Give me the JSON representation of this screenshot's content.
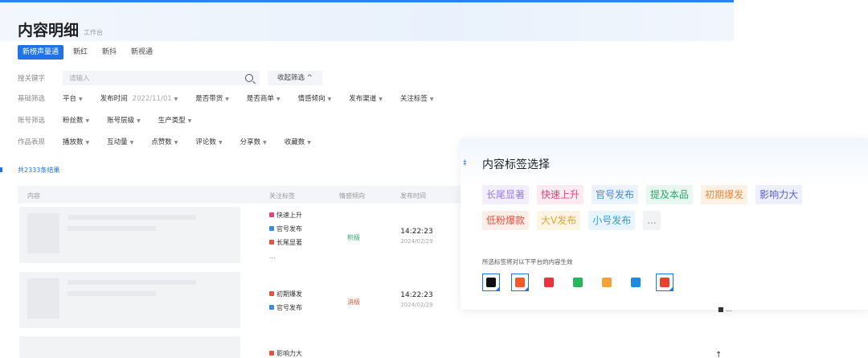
{
  "header": {
    "title": "内容明细",
    "subtitle": "工作台"
  },
  "tabs": [
    {
      "label": "新榜声量通",
      "active": true
    },
    {
      "label": "新红",
      "active": false
    },
    {
      "label": "新抖",
      "active": false
    },
    {
      "label": "新视通",
      "active": false
    }
  ],
  "search": {
    "label": "搜关键字",
    "placeholder": "请输入",
    "collapse_label": "收起筛选 ^"
  },
  "filters": {
    "basic": {
      "label": "基础筛选",
      "items": [
        "平台",
        "发布时间",
        "是否带货",
        "是否商单",
        "情感倾向",
        "发布渠道",
        "关注标签"
      ],
      "date_value": "2022/11/01"
    },
    "account": {
      "label": "账号筛选",
      "items": [
        "粉丝数",
        "账号层级",
        "生产类型"
      ]
    },
    "works": {
      "label": "作品表现",
      "items": [
        "播放数",
        "互动量",
        "点赞数",
        "评论数",
        "分享数",
        "收藏数"
      ]
    }
  },
  "result_count": "共2333条结果",
  "table": {
    "headers": {
      "content": "内容",
      "tags": "关注标签",
      "emotion": "情感倾向",
      "time": "发布时间"
    },
    "rows": [
      {
        "tags": [
          "快速上升",
          "官号发布",
          "长尾显著",
          "..."
        ],
        "emotion": "积极",
        "time": "14:22:23",
        "date": "2024/02/29"
      },
      {
        "tags": [
          "初期爆发",
          "官号发布"
        ],
        "emotion": "消极",
        "time": "14:22:23",
        "date": "2024/02/29"
      },
      {
        "tags": [
          "影响力大"
        ],
        "emotion": "",
        "time": "",
        "date": ""
      }
    ]
  },
  "panel": {
    "title": "内容标签选择",
    "chips": [
      {
        "label": "长尾显著",
        "color": "#9a7fd8",
        "bg": "#f2eefc"
      },
      {
        "label": "快速上升",
        "color": "#e0457b",
        "bg": "#fdebf1"
      },
      {
        "label": "官号发布",
        "color": "#3b8be8",
        "bg": "#ebf3fd"
      },
      {
        "label": "提及本品",
        "color": "#2fa86a",
        "bg": "#e8f7ef"
      },
      {
        "label": "初期爆发",
        "color": "#f08a3c",
        "bg": "#fdf1e6"
      },
      {
        "label": "影响力大",
        "color": "#5b5fc7",
        "bg": "#eeeffc"
      },
      {
        "label": "低粉爆款",
        "color": "#e5553e",
        "bg": "#fdeeea"
      },
      {
        "label": "大V发布",
        "color": "#e3a335",
        "bg": "#fdf5e4"
      },
      {
        "label": "小号发布",
        "color": "#2b9fd3",
        "bg": "#e8f5fc"
      },
      {
        "label": "...",
        "color": "#999999",
        "bg": "#f2f3f5"
      }
    ],
    "note": "所选标签将对以下平台的内容生效",
    "platforms": [
      {
        "name": "douyin-icon",
        "color": "#111111",
        "selected": true
      },
      {
        "name": "kuaishou-icon",
        "color": "#f25a2a",
        "selected": true
      },
      {
        "name": "xiaohongshu-icon",
        "color": "#e8333f",
        "selected": false
      },
      {
        "name": "wechat-icon",
        "color": "#29b55b",
        "selected": false
      },
      {
        "name": "bilibili-icon",
        "color": "#f6a13b",
        "selected": false
      },
      {
        "name": "zhihu-icon",
        "color": "#1f8be0",
        "selected": false
      },
      {
        "name": "weibo-icon",
        "color": "#e6432c",
        "selected": true
      }
    ]
  },
  "stray": {
    "right_text_1": "■ ...",
    "right_text_2": "↑"
  }
}
